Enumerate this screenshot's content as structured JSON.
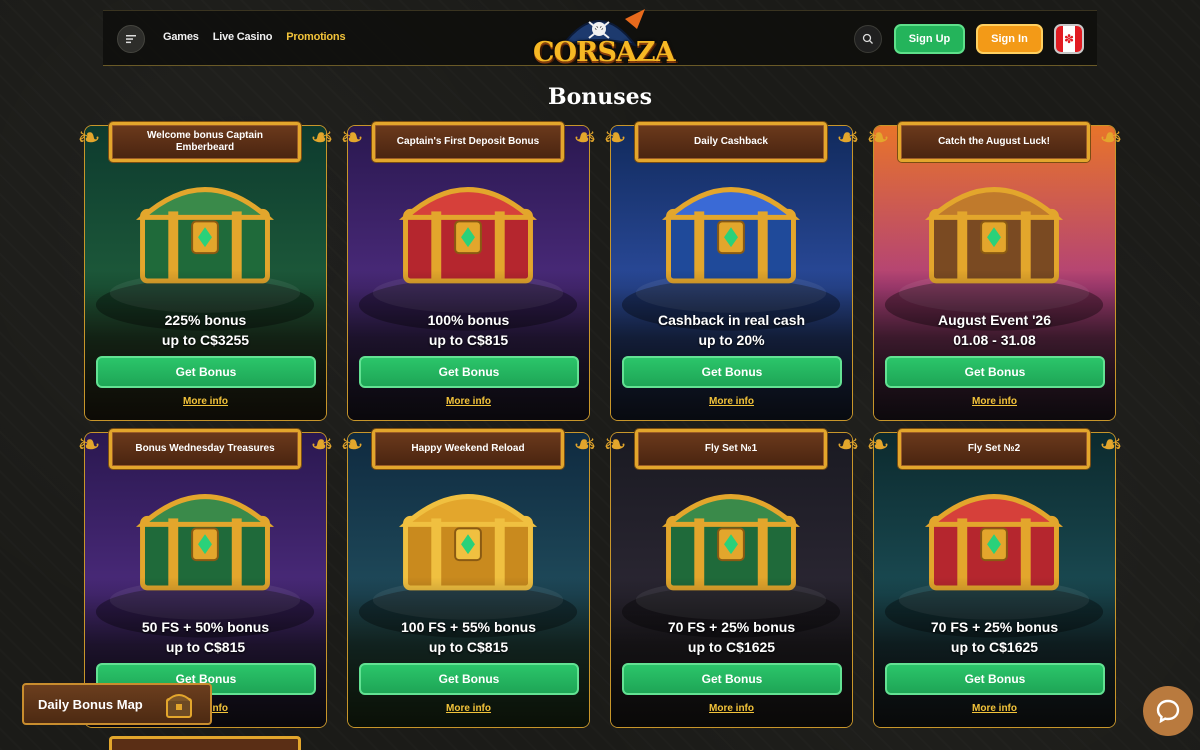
{
  "header": {
    "nav": [
      {
        "label": "Games",
        "active": false
      },
      {
        "label": "Live Casino",
        "active": false
      },
      {
        "label": "Promotions",
        "active": true
      }
    ],
    "logo_text": "CORSAZA",
    "signup_label": "Sign Up",
    "signin_label": "Sign In",
    "flag": "canada-flag-icon"
  },
  "page_title": "Bonuses",
  "cards": [
    {
      "title": "Welcome bonus Captain Emberbeard",
      "line1": "225% bonus",
      "line2": "up to C$3255",
      "button": "Get Bonus",
      "link": "More info",
      "theme": "jungle",
      "chest": "green"
    },
    {
      "title": "Captain's First Deposit Bonus",
      "line1": "100% bonus",
      "line2": "up to C$815",
      "button": "Get Bonus",
      "link": "More info",
      "theme": "purple",
      "chest": "red"
    },
    {
      "title": "Daily Cashback",
      "line1": "Cashback in real cash",
      "line2": "up to 20%",
      "button": "Get Bonus",
      "link": "More info",
      "theme": "blue",
      "chest": "blue"
    },
    {
      "title": "Catch the August Luck!",
      "line1": "August Event '26",
      "line2": "01.08 - 31.08",
      "button": "Get Bonus",
      "link": "More info",
      "theme": "sunset",
      "chest": "treasure"
    },
    {
      "title": "Bonus Wednesday Treasures",
      "line1": "50 FS + 50% bonus",
      "line2": "up to C$815",
      "button": "Get Bonus",
      "link": "More info",
      "theme": "purple",
      "chest": "green"
    },
    {
      "title": "Happy Weekend Reload",
      "line1": "100 FS + 55% bonus",
      "line2": "up to C$815",
      "button": "Get Bonus",
      "link": "More info",
      "theme": "forest",
      "chest": "gold"
    },
    {
      "title": "Fly Set №1",
      "line1": "70 FS + 25% bonus",
      "line2": "up to C$1625",
      "button": "Get Bonus",
      "link": "More info",
      "theme": "dark",
      "chest": "green"
    },
    {
      "title": "Fly Set №2",
      "line1": "70 FS + 25% bonus",
      "line2": "up to C$1625",
      "button": "Get Bonus",
      "link": "More info",
      "theme": "teal",
      "chest": "red"
    }
  ],
  "floaters": {
    "daily_map_label": "Daily Bonus Map",
    "chat_icon": "chat-bubble-icon"
  },
  "colors": {
    "accent_gold": "#f2c33a",
    "button_green": "#24b45b",
    "button_orange": "#f39a17",
    "card_border": "#c8962a"
  }
}
